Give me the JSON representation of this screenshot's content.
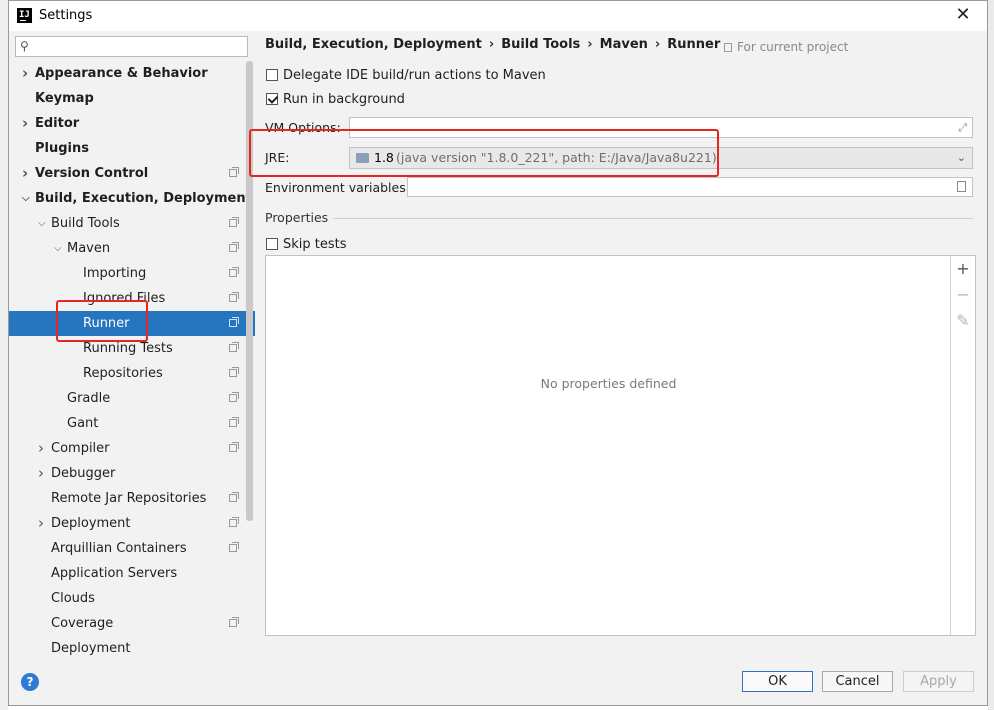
{
  "window": {
    "title": "Settings"
  },
  "sidebar": {
    "search_placeholder": "",
    "items": [
      {
        "label": "Appearance & Behavior",
        "bold": true,
        "arrow": "right"
      },
      {
        "label": "Keymap",
        "bold": true
      },
      {
        "label": "Editor",
        "bold": true,
        "arrow": "right"
      },
      {
        "label": "Plugins",
        "bold": true
      },
      {
        "label": "Version Control",
        "bold": true,
        "arrow": "right",
        "copy": true
      },
      {
        "label": "Build, Execution, Deployment",
        "bold": true,
        "arrow": "down"
      },
      {
        "label": "Build Tools",
        "arrow": "down",
        "copy": true
      },
      {
        "label": "Maven",
        "arrow": "down",
        "copy": true
      },
      {
        "label": "Importing",
        "copy": true
      },
      {
        "label": "Ignored Files",
        "copy": true
      },
      {
        "label": "Runner",
        "copy": true,
        "selected": true
      },
      {
        "label": "Running Tests",
        "copy": true
      },
      {
        "label": "Repositories",
        "copy": true
      },
      {
        "label": "Gradle",
        "copy": true
      },
      {
        "label": "Gant",
        "copy": true
      },
      {
        "label": "Compiler",
        "arrow": "right",
        "copy": true
      },
      {
        "label": "Debugger",
        "arrow": "right"
      },
      {
        "label": "Remote Jar Repositories",
        "copy": true
      },
      {
        "label": "Deployment",
        "arrow": "right",
        "copy": true
      },
      {
        "label": "Arquillian Containers",
        "copy": true
      },
      {
        "label": "Application Servers"
      },
      {
        "label": "Clouds"
      },
      {
        "label": "Coverage",
        "copy": true
      },
      {
        "label": "Deployment"
      }
    ]
  },
  "breadcrumb": {
    "parts": [
      "Build, Execution, Deployment",
      "Build Tools",
      "Maven",
      "Runner"
    ],
    "separator": "›",
    "scope": "For current project"
  },
  "options": {
    "delegate_label": "Delegate IDE build/run actions to Maven",
    "delegate_checked": false,
    "background_label": "Run in background",
    "background_checked": true,
    "vm_options_label": "VM Options:",
    "vm_options_value": "",
    "jre_label": "JRE:",
    "jre_version": "1.8",
    "jre_detail": "(java version \"1.8.0_221\", path: E:/Java/Java8u221)",
    "env_label": "Environment variables:",
    "env_value": ""
  },
  "properties": {
    "title": "Properties",
    "skip_tests_label": "Skip tests",
    "skip_tests_checked": false,
    "empty_text": "No properties defined",
    "add_icon": "+",
    "remove_icon": "−",
    "edit_icon": "✎"
  },
  "footer": {
    "help_icon": "?",
    "ok_label": "OK",
    "cancel_label": "Cancel",
    "apply_label": "Apply"
  },
  "colors": {
    "selection": "#2675bf",
    "highlight_box": "#e8261f",
    "help_icon": "#2e7bd6"
  }
}
